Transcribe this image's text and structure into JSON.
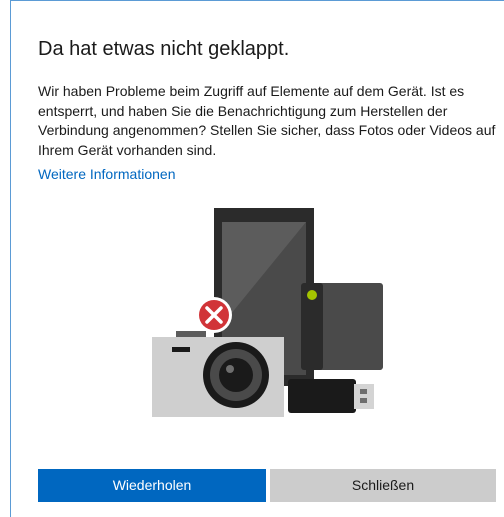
{
  "dialog": {
    "title": "Da hat etwas nicht geklappt.",
    "message": "Wir haben Probleme beim Zugriff auf Elemente auf dem Gerät. Ist es entsperrt, und haben Sie die Benachrichtigung zum Herstellen der Verbindung angenommen? Stellen Sie sicher, dass Fotos oder Videos auf Ihrem Gerät vorhanden sind.",
    "more_info_link": "Weitere Informationen",
    "buttons": {
      "retry_label": "Wiederholen",
      "close_label": "Schließen"
    },
    "illustration": {
      "devices": [
        "phone-icon",
        "camera-icon",
        "external-drive-icon",
        "usb-stick-icon"
      ],
      "status_icon": "error-icon"
    }
  },
  "colors": {
    "accent": "#0067c0",
    "secondary_button": "#cccccc",
    "error": "#d13438",
    "drive_led": "#a4c400",
    "frame_border": "#5b9bd5"
  }
}
